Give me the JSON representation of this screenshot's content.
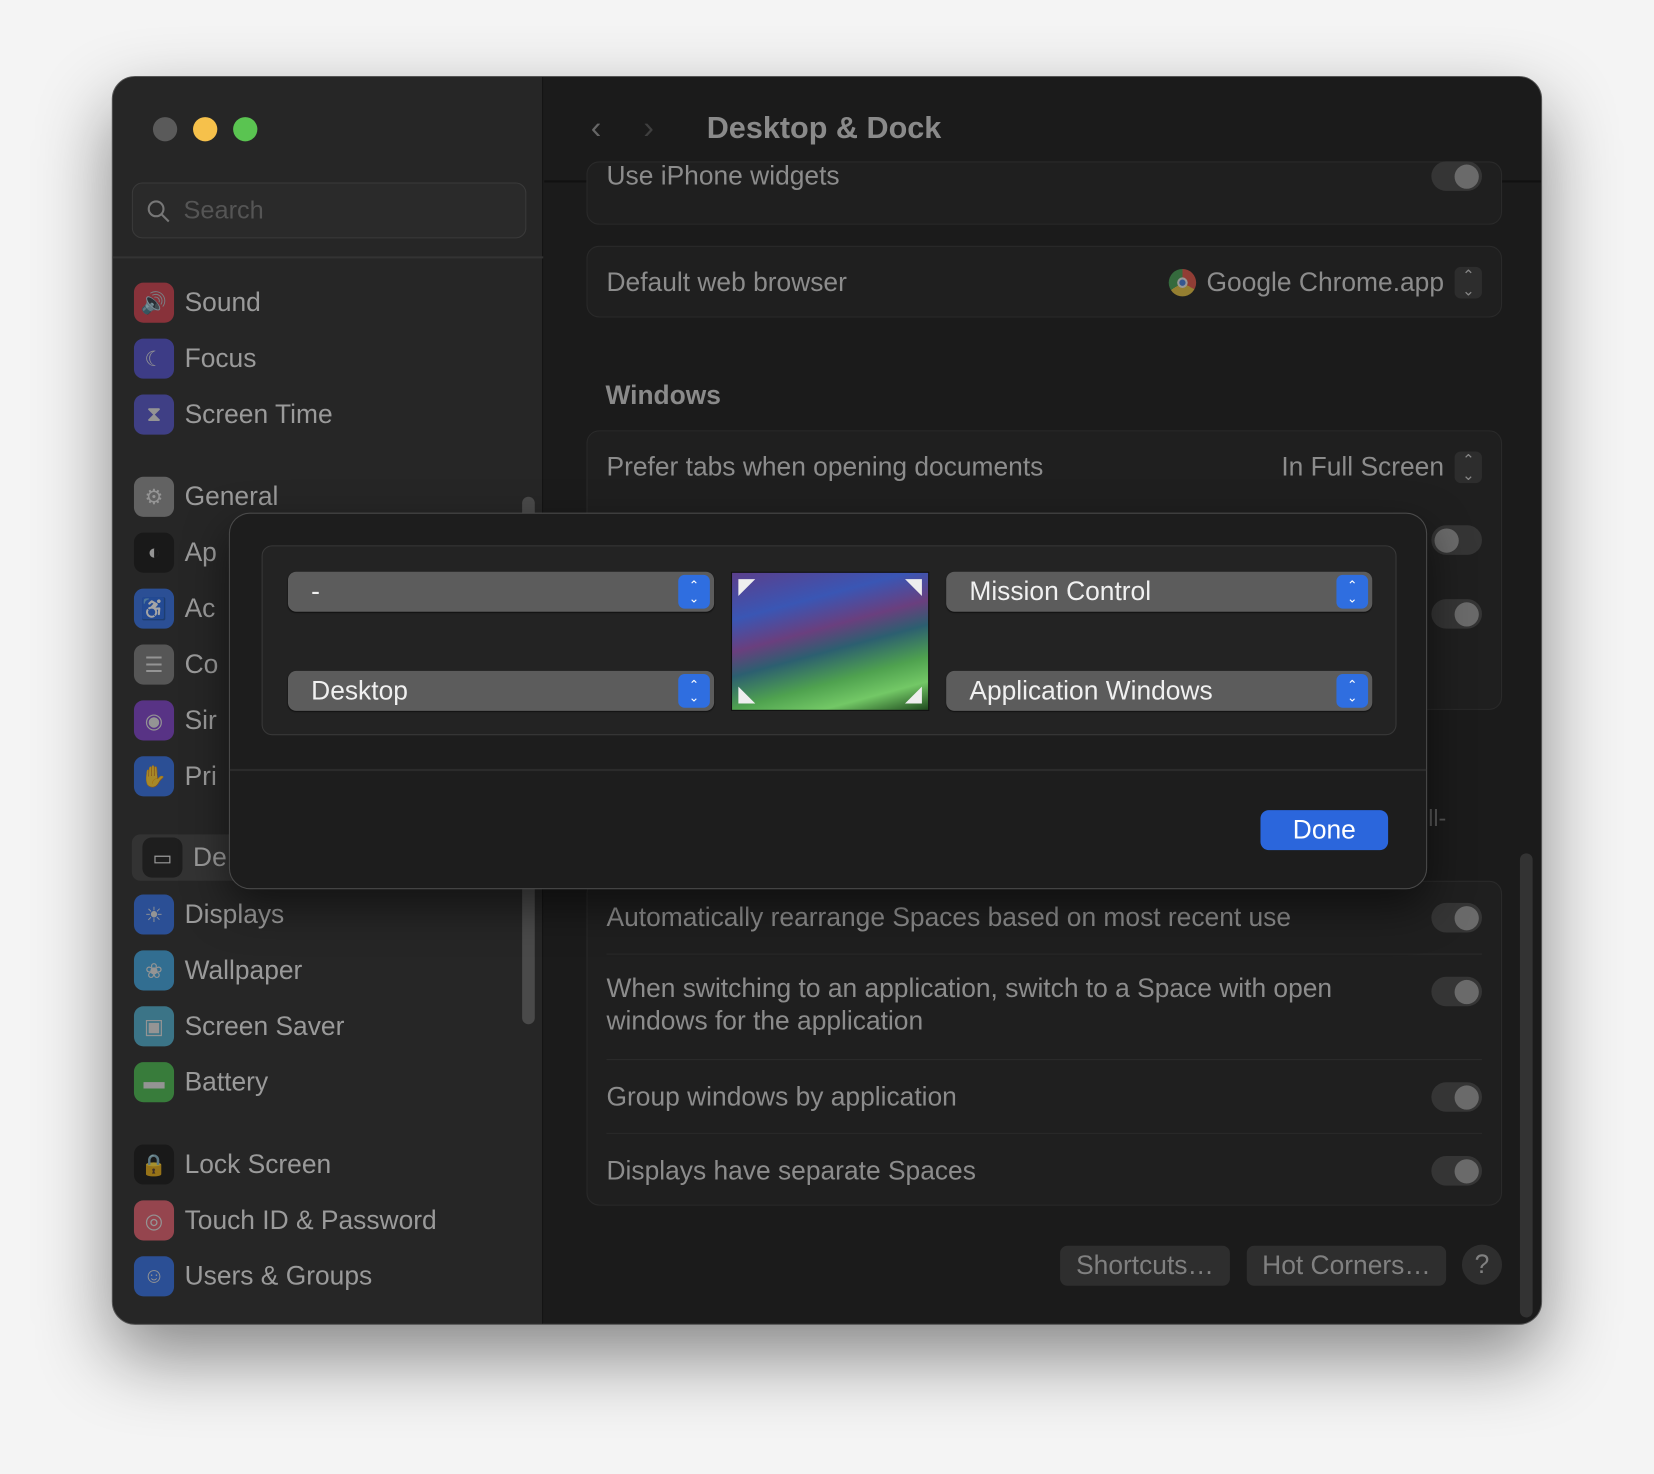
{
  "window": {
    "title": "Desktop & Dock",
    "traffic_lights": {
      "close": "#5a5a5a",
      "minimize": "#f6c14b",
      "zoom": "#5ac451"
    }
  },
  "sidebar": {
    "search_placeholder": "Search",
    "items": [
      {
        "label": "Sound",
        "icon": "speaker-icon",
        "color": "#c93a48"
      },
      {
        "label": "Focus",
        "icon": "moon-icon",
        "color": "#4d4cc7"
      },
      {
        "label": "Screen Time",
        "icon": "hourglass-icon",
        "color": "#5150c5"
      },
      {
        "label": "General",
        "icon": "gear-icon",
        "color": "#8a8a8a"
      },
      {
        "label": "Ap",
        "icon": "appearance-icon",
        "color": "#111111"
      },
      {
        "label": "Ac",
        "icon": "accessibility-icon",
        "color": "#2f6be0"
      },
      {
        "label": "Co",
        "icon": "control-center-icon",
        "color": "#777777"
      },
      {
        "label": "Sir",
        "icon": "siri-icon",
        "color": "#7a3cc4"
      },
      {
        "label": "Pri",
        "icon": "hand-icon",
        "color": "#2f6be0"
      },
      {
        "label": "De",
        "icon": "dock-icon",
        "color": "#111111",
        "selected": true
      },
      {
        "label": "Displays",
        "icon": "sun-icon",
        "color": "#2f6be0"
      },
      {
        "label": "Wallpaper",
        "icon": "flower-icon",
        "color": "#3a9fd8"
      },
      {
        "label": "Screen Saver",
        "icon": "screensaver-icon",
        "color": "#4aa8c8"
      },
      {
        "label": "Battery",
        "icon": "battery-icon",
        "color": "#45b54a"
      },
      {
        "label": "Lock Screen",
        "icon": "lock-icon",
        "color": "#111111"
      },
      {
        "label": "Touch ID & Password",
        "icon": "fingerprint-icon",
        "color": "#e05a6a"
      },
      {
        "label": "Users & Groups",
        "icon": "users-icon",
        "color": "#2f6be0"
      }
    ]
  },
  "main": {
    "rows_top": [
      {
        "label": "Use iPhone widgets",
        "toggle": true
      },
      {
        "label": "Default web browser",
        "value": "Google Chrome.app"
      }
    ],
    "windows_section": {
      "title": "Windows",
      "prefer_tabs": {
        "label": "Prefer tabs when opening documents",
        "value": "In Full Screen"
      },
      "hidden_toggles": [
        false,
        true
      ],
      "partial_text": "ll-"
    },
    "spaces_rows": [
      {
        "label": "Automatically rearrange Spaces based on most recent use",
        "toggle": true
      },
      {
        "label": "When switching to an application, switch to a Space with open windows for the application",
        "toggle": true
      },
      {
        "label": "Group windows by application",
        "toggle": true
      },
      {
        "label": "Displays have separate Spaces",
        "toggle": true
      }
    ],
    "buttons": {
      "shortcuts": "Shortcuts…",
      "hot_corners": "Hot Corners…",
      "help": "?"
    }
  },
  "hot_corners_dialog": {
    "top_left": "-",
    "bottom_left": "Desktop",
    "top_right": "Mission Control",
    "bottom_right": "Application Windows",
    "done": "Done",
    "accent": "#2b66dc"
  }
}
